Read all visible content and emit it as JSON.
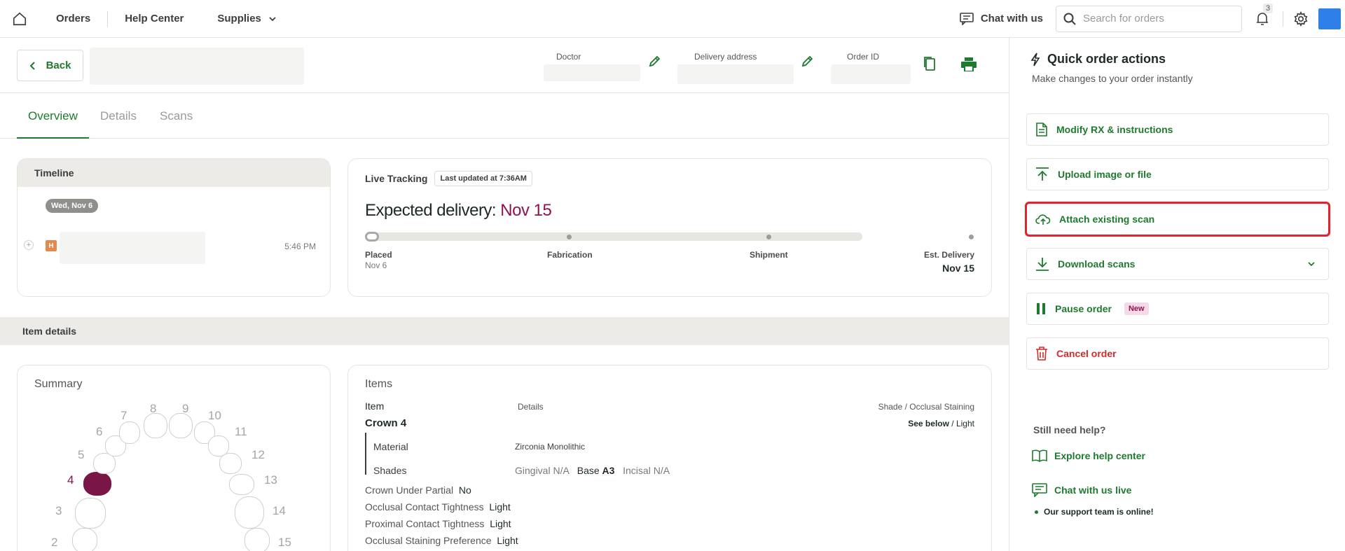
{
  "nav": {
    "orders": "Orders",
    "help_center": "Help Center",
    "supplies": "Supplies",
    "chat": "Chat with us",
    "search_placeholder": "Search for orders",
    "notif_count": "3"
  },
  "order_bar": {
    "back": "Back",
    "doctor_label": "Doctor",
    "delivery_label": "Delivery address",
    "order_id_label": "Order ID"
  },
  "tabs": [
    "Overview",
    "Details",
    "Scans"
  ],
  "timeline": {
    "title": "Timeline",
    "date": "Wed, Nov 6",
    "badge": "H",
    "time": "5:46 PM"
  },
  "tracking": {
    "title": "Live Tracking",
    "last_updated": "Last updated at 7:36AM",
    "expected_label": "Expected delivery:",
    "expected_date": "Nov 15",
    "progress": 0.0,
    "stages": [
      "Placed",
      "Fabrication",
      "Shipment",
      "Est. Delivery"
    ],
    "placed_date": "Nov 6",
    "est_date": "Nov 15"
  },
  "item_details": {
    "title": "Item details"
  },
  "summary": {
    "title": "Summary",
    "tooth_numbers": [
      "2",
      "3",
      "4",
      "5",
      "6",
      "7",
      "8",
      "9",
      "10",
      "11",
      "12",
      "13",
      "14",
      "15"
    ],
    "selected_tooth": "4",
    "selected_color": "#7a1547"
  },
  "items": {
    "title": "Items",
    "col_item": "Item",
    "col_details": "Details",
    "col_shade": "Shade / Occlusal Staining",
    "crown": "Crown 4",
    "see_below": "See below",
    "slash": "/",
    "light": "Light",
    "material_label": "Material",
    "material_value": "Zirconia Monolithic",
    "shades_label": "Shades",
    "gingival_label": "Gingival",
    "gingival_value": "N/A",
    "base_label": "Base",
    "base_value": "A3",
    "incisal_label": "Incisal",
    "incisal_value": "N/A",
    "rows": [
      {
        "label": "Crown Under Partial",
        "value": "No"
      },
      {
        "label": "Occlusal Contact Tightness",
        "value": "Light"
      },
      {
        "label": "Proximal Contact Tightness",
        "value": "Light"
      },
      {
        "label": "Occlusal Staining Preference",
        "value": "Light"
      }
    ]
  },
  "quick_actions": {
    "title": "Quick order actions",
    "subtitle": "Make changes to your order instantly",
    "buttons": [
      {
        "label": "Modify RX & instructions"
      },
      {
        "label": "Upload image or file"
      },
      {
        "label": "Attach existing scan"
      },
      {
        "label": "Download scans"
      },
      {
        "label": "Pause order",
        "badge": "New"
      },
      {
        "label": "Cancel order"
      }
    ]
  },
  "help": {
    "title": "Still need help?",
    "explore": "Explore help center",
    "chat": "Chat with us live",
    "online": "Our support team is online!"
  }
}
